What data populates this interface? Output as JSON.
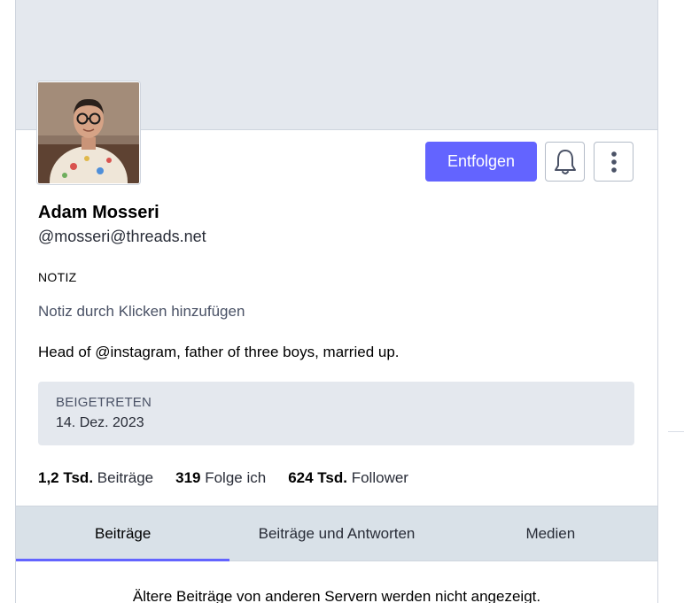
{
  "profile": {
    "display_name": "Adam Mosseri",
    "handle": "@mosseri@threads.net",
    "bio": "Head of @instagram, father of three boys, married up.",
    "note_label": "NOTIZ",
    "note_placeholder": "Notiz durch Klicken hinzufügen",
    "joined_label": "BEIGETRETEN",
    "joined_date": "14. Dez. 2023"
  },
  "actions": {
    "unfollow_label": "Entfolgen",
    "bell_icon": "bell-icon",
    "more_icon": "more-vertical-icon"
  },
  "stats": {
    "posts_count": "1,2 Tsd.",
    "posts_label": "Beiträge",
    "following_count": "319",
    "following_label": "Folge ich",
    "followers_count": "624 Tsd.",
    "followers_label": "Follower"
  },
  "tabs": [
    {
      "label": "Beiträge",
      "active": true
    },
    {
      "label": "Beiträge und Antworten",
      "active": false
    },
    {
      "label": "Medien",
      "active": false
    }
  ],
  "footer_note": "Ältere Beiträge von anderen Servern werden nicht angezeigt.",
  "colors": {
    "accent": "#6364ff",
    "banner": "#e4e8ee",
    "tab_bar": "#d9e1e8"
  }
}
